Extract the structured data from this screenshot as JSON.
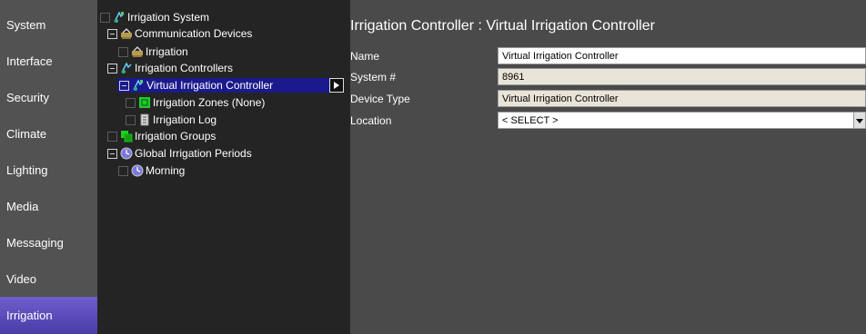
{
  "leftnav": {
    "items": [
      {
        "label": "System"
      },
      {
        "label": "Interface"
      },
      {
        "label": "Security"
      },
      {
        "label": "Climate"
      },
      {
        "label": "Lighting"
      },
      {
        "label": "Media"
      },
      {
        "label": "Messaging"
      },
      {
        "label": "Video"
      },
      {
        "label": "Irrigation",
        "active": true
      }
    ]
  },
  "tree": {
    "nodes": [
      {
        "label": "Irrigation System",
        "icon": "irrigation-system-icon"
      },
      {
        "label": "Communication Devices",
        "icon": "communication-devices-icon"
      },
      {
        "label": "Irrigation",
        "icon": "communication-device-icon"
      },
      {
        "label": "Irrigation Controllers",
        "icon": "irrigation-controllers-icon"
      },
      {
        "label": "Virtual Irrigation Controller",
        "icon": "controller-icon",
        "selected": true
      },
      {
        "label": "Irrigation Zones (None)",
        "icon": "zones-icon"
      },
      {
        "label": "Irrigation Log",
        "icon": "log-icon"
      },
      {
        "label": "Irrigation Groups",
        "icon": "groups-icon"
      },
      {
        "label": "Global Irrigation Periods",
        "icon": "clock-icon"
      },
      {
        "label": "Morning",
        "icon": "clock-icon"
      }
    ]
  },
  "panel": {
    "title": "Irrigation Controller : Virtual Irrigation Controller",
    "fields": {
      "name": {
        "label": "Name",
        "value": "Virtual Irrigation Controller"
      },
      "system": {
        "label": "System #",
        "value": "8961"
      },
      "device_type": {
        "label": "Device Type",
        "value": "Virtual Irrigation Controller"
      },
      "location": {
        "label": "Location",
        "value": "< SELECT >"
      }
    }
  },
  "colors": {
    "nav_bg": "#525252",
    "nav_active": "#5a4bbd",
    "tree_bg": "#242424",
    "tree_selected": "#1a1a8c",
    "panel_bg": "#4a4a4a",
    "readonly_field": "#e8e4d8"
  }
}
